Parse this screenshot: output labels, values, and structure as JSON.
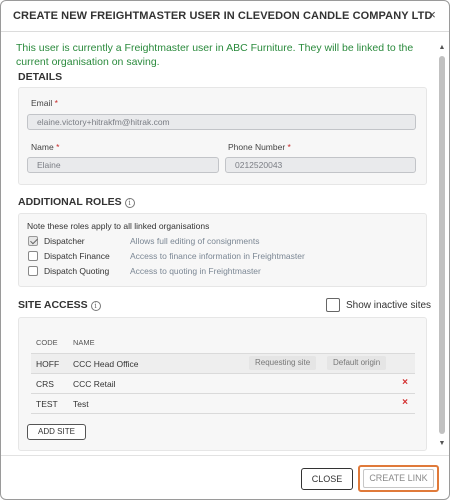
{
  "dialog": {
    "title": "CREATE NEW FREIGHTMASTER USER IN CLEVEDON CANDLE COMPANY LTD",
    "close_glyph": "×",
    "notice": "This user is currently a Freightmaster user in ABC Furniture. They will be linked to the current organisation on saving."
  },
  "details": {
    "title": "DETAILS",
    "email_label": "Email",
    "email_value": "elaine.victory+hitrakfm@hitrak.com",
    "name_label": "Name",
    "name_value": "Elaine",
    "phone_label": "Phone Number",
    "phone_value": "0212520043",
    "required_mark": "*"
  },
  "roles": {
    "title": "ADDITIONAL ROLES",
    "info_glyph": "i",
    "note": "Note these roles apply to all linked organisations",
    "items": [
      {
        "name": "Dispatcher",
        "description": "Allows full editing of consignments",
        "checked": true
      },
      {
        "name": "Dispatch Finance",
        "description": "Access to finance information in Freightmaster",
        "checked": false
      },
      {
        "name": "Dispatch Quoting",
        "description": "Access to quoting in Freightmaster",
        "checked": false
      }
    ]
  },
  "site_access": {
    "title": "SITE ACCESS",
    "info_glyph": "i",
    "show_inactive_label": "Show inactive sites",
    "show_inactive_checked": false,
    "columns": {
      "code": "CODE",
      "name": "NAME"
    },
    "rows": [
      {
        "code": "HOFF",
        "name": "CCC Head Office",
        "tag_requesting": "Requesting site",
        "tag_default": "Default origin",
        "delete": ""
      },
      {
        "code": "CRS",
        "name": "CCC Retail",
        "tag_requesting": "",
        "tag_default": "",
        "delete": "×"
      },
      {
        "code": "TEST",
        "name": "Test",
        "tag_requesting": "",
        "tag_default": "",
        "delete": "×"
      }
    ],
    "add_site_label": "ADD SITE"
  },
  "scrollbar": {
    "up_glyph": "▲",
    "down_glyph": "▼"
  },
  "footer": {
    "close_label": "CLOSE",
    "create_link_label": "CREATE LINK"
  },
  "colors": {
    "notice_green": "#2a8a3c",
    "required_red": "#c62828",
    "delete_red": "#d32f2f",
    "focus_orange": "#e07a3a"
  }
}
